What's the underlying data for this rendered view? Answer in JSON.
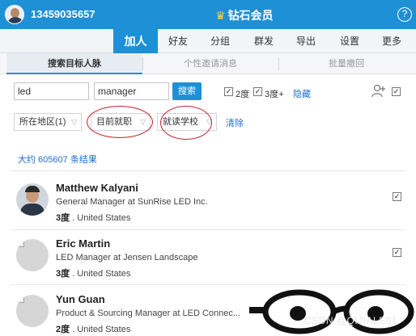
{
  "titlebar": {
    "phone": "13459035657",
    "vip_label": "钻石会员",
    "help_label": "?"
  },
  "nav": {
    "tabs": [
      "加人",
      "好友",
      "分组",
      "群发",
      "导出",
      "设置",
      "更多"
    ],
    "active": "加人"
  },
  "subtabs": {
    "items": [
      "搜索目标人脉",
      "个性邀请消息",
      "批量撤回"
    ]
  },
  "search": {
    "keyword1": "led",
    "keyword2": "manager",
    "button": "搜索",
    "deg2_label": "2度",
    "deg3_label": "3度+",
    "hide_link": "隐藏"
  },
  "filters": {
    "region": "所在地区(1)",
    "current_job": "目前就职",
    "school": "就读学校",
    "clear": "清除"
  },
  "results": {
    "count_text": "大约 605607 条结果",
    "people": [
      {
        "name": "Matthew Kalyani",
        "title": "General Manager at SunRise LED Inc.",
        "degree": "3度",
        "location": ". United States"
      },
      {
        "name": "Eric Martin",
        "title": "LED Manager at Jensen Landscape",
        "degree": "3度",
        "location": ". United States"
      },
      {
        "name": "Yun Guan",
        "title": "Product & Sourcing Manager at LED Connec...",
        "degree": "2度",
        "location": ". United States"
      }
    ]
  },
  "watermark": "CSDN @QIJIALE01",
  "icons": {
    "help": "help-icon",
    "crown": "crown-icon",
    "add_person": "add-person-icon",
    "chevron": "chevron-down-icon"
  },
  "colors": {
    "brand": "#1e90d6",
    "link": "#1e6fd0",
    "annotation": "#c0212a"
  }
}
